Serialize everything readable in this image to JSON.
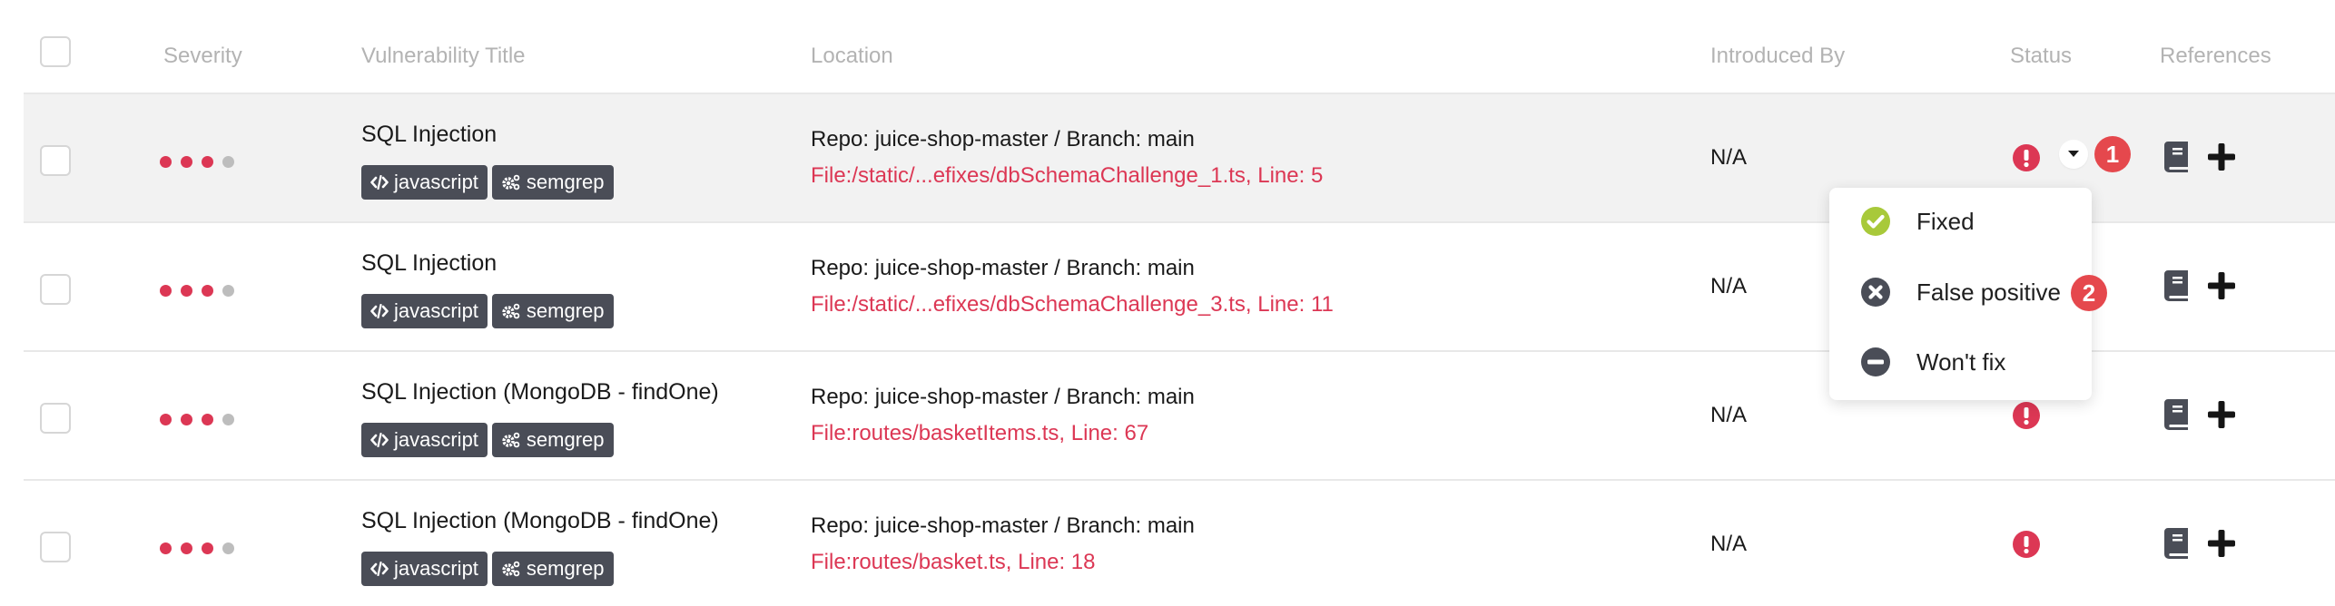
{
  "header": {
    "columns": [
      "Severity",
      "Vulnerability Title",
      "Location",
      "Introduced By",
      "Status",
      "References"
    ]
  },
  "colors": {
    "severity_on": "#dc3754",
    "severity_off": "#bdbdbd",
    "file_link": "#dc3754",
    "tag_bg": "#4a4d57",
    "badge": "#e5484d",
    "fixed_icon": "#a8c93a",
    "neutral_icon": "#4a4d57"
  },
  "rows": [
    {
      "severity": {
        "level": 3,
        "max": 4
      },
      "title": "SQL Injection",
      "tags": [
        {
          "icon": "code-icon",
          "label": "javascript"
        },
        {
          "icon": "cogs-icon",
          "label": "semgrep"
        }
      ],
      "repo": "Repo: juice-shop-master / Branch: main",
      "file": "File:/static/...efixes/dbSchemaChallenge_1.ts, Line: 5",
      "introduced_by": "N/A",
      "status_icon": "exclamation-circle-icon",
      "highlighted": true
    },
    {
      "severity": {
        "level": 3,
        "max": 4
      },
      "title": "SQL Injection",
      "tags": [
        {
          "icon": "code-icon",
          "label": "javascript"
        },
        {
          "icon": "cogs-icon",
          "label": "semgrep"
        }
      ],
      "repo": "Repo: juice-shop-master / Branch: main",
      "file": "File:/static/...efixes/dbSchemaChallenge_3.ts, Line: 11",
      "introduced_by": "N/A",
      "status_icon": "exclamation-circle-icon",
      "highlighted": false
    },
    {
      "severity": {
        "level": 3,
        "max": 4
      },
      "title": "SQL Injection (MongoDB - findOne)",
      "tags": [
        {
          "icon": "code-icon",
          "label": "javascript"
        },
        {
          "icon": "cogs-icon",
          "label": "semgrep"
        }
      ],
      "repo": "Repo: juice-shop-master / Branch: main",
      "file": "File:routes/basketItems.ts, Line: 67",
      "introduced_by": "N/A",
      "status_icon": "exclamation-circle-icon",
      "highlighted": false
    },
    {
      "severity": {
        "level": 3,
        "max": 4
      },
      "title": "SQL Injection (MongoDB - findOne)",
      "tags": [
        {
          "icon": "code-icon",
          "label": "javascript"
        },
        {
          "icon": "cogs-icon",
          "label": "semgrep"
        }
      ],
      "repo": "Repo: juice-shop-master / Branch: main",
      "file": "File:routes/basket.ts, Line: 18",
      "introduced_by": "N/A",
      "status_icon": "exclamation-circle-icon",
      "highlighted": false
    }
  ],
  "status_menu": {
    "items": [
      {
        "icon": "check-circle-icon",
        "label": "Fixed"
      },
      {
        "icon": "times-circle-icon",
        "label": "False positive"
      },
      {
        "icon": "minus-circle-icon",
        "label": "Won't fix"
      }
    ]
  },
  "annotations": {
    "step1": "1",
    "step2": "2"
  }
}
